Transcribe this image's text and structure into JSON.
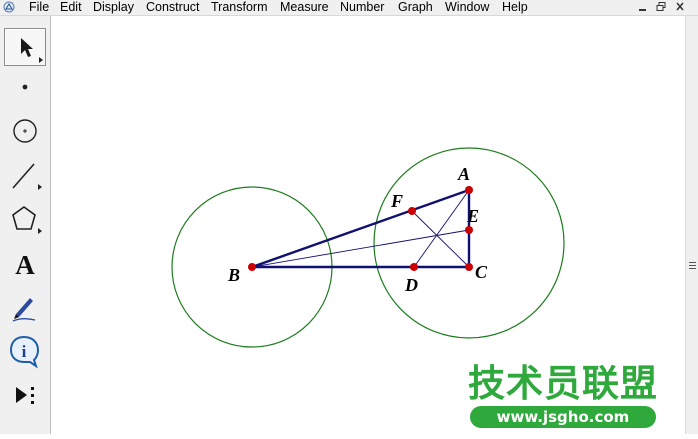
{
  "menu": {
    "items": [
      "File",
      "Edit",
      "Display",
      "Construct",
      "Transform",
      "Measure",
      "Number",
      "Graph",
      "Window",
      "Help"
    ]
  },
  "window_controls": [
    "minimize",
    "restore",
    "close"
  ],
  "toolbar": {
    "tools": [
      "arrow-tool",
      "point-tool",
      "compass-tool",
      "straightedge-tool",
      "polygon-tool",
      "text-tool",
      "marker-tool",
      "information-tool",
      "custom-tool"
    ],
    "text_tool_glyph": "A",
    "info_tool_glyph": "i"
  },
  "figure": {
    "points": {
      "A": "A",
      "B": "B",
      "C": "C",
      "D": "D",
      "E": "E",
      "F": "F"
    },
    "colors": {
      "circle": "#1e7d1e",
      "segment": "#101070",
      "point": "#cc0000"
    }
  },
  "watermark": {
    "title": "技术员联盟",
    "url": "www.jsgho.com"
  },
  "colors": {
    "watermark_green": "#2fa83c",
    "chrome": "#f0f0f0"
  }
}
